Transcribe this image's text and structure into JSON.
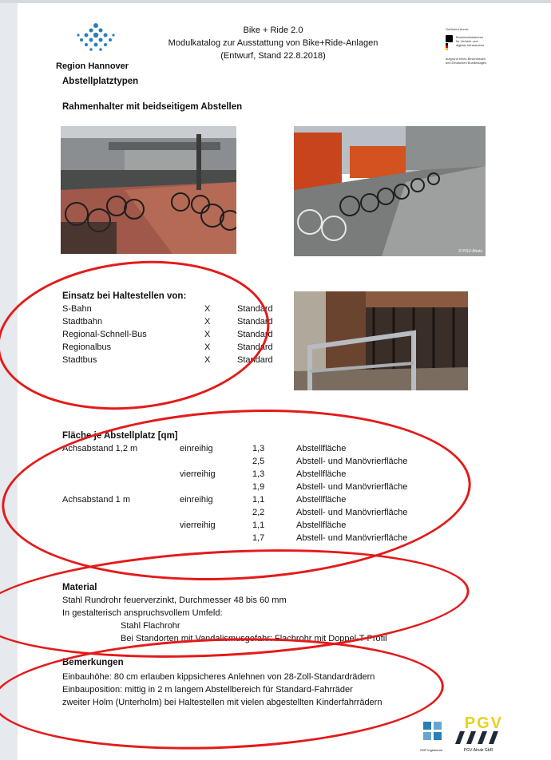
{
  "header": {
    "org": "Region Hannover",
    "line1": "Bike + Ride 2.0",
    "line2": "Modulkatalog zur Ausstattung von Bike+Ride-Anlagen",
    "line3": "(Entwurf, Stand 22.8.2018)",
    "funder_top": "Gefördert durch:",
    "funder_ministry": [
      "Bundesministerium",
      "für Verkehr und",
      "digitale Infrastruktur"
    ],
    "funder_bottom": [
      "aufgrund eines Beschlusses",
      "des Deutschen Bundestages"
    ]
  },
  "section_title": "Abstellplatztypen",
  "subtitle": "Rahmenhalter mit beidseitigem Abstellen",
  "photo_credit": "© PGV-Alrutz",
  "einsatz": {
    "heading": "Einsatz bei Haltestellen von:",
    "rows": [
      {
        "name": "S-Bahn",
        "mark": "X",
        "status": "Standard"
      },
      {
        "name": "Stadtbahn",
        "mark": "X",
        "status": "Standard"
      },
      {
        "name": "Regional-Schnell-Bus",
        "mark": "X",
        "status": "Standard"
      },
      {
        "name": "Regionalbus",
        "mark": "X",
        "status": "Standard"
      },
      {
        "name": "Stadtbus",
        "mark": "X",
        "status": "Standard"
      }
    ]
  },
  "flaeche": {
    "heading": "Fläche je Abstellplatz [qm]",
    "rows": [
      {
        "a": "Achsabstand 1,2 m",
        "b": "einreihig",
        "v": "1,3",
        "d": "Abstellfläche"
      },
      {
        "a": "",
        "b": "",
        "v": "2,5",
        "d": "Abstell- und Manövrierfläche"
      },
      {
        "a": "",
        "b": "vierreihig",
        "v": "1,3",
        "d": "Abstellfläche"
      },
      {
        "a": "",
        "b": "",
        "v": "1,9",
        "d": "Abstell- und Manövrierfläche"
      },
      {
        "a": "Achsabstand 1 m",
        "b": "einreihig",
        "v": "1,1",
        "d": "Abstellfläche"
      },
      {
        "a": "",
        "b": "",
        "v": "2,2",
        "d": "Abstell- und Manövrierfläche"
      },
      {
        "a": "",
        "b": "vierreihig",
        "v": "1,1",
        "d": "Abstellfläche"
      },
      {
        "a": "",
        "b": "",
        "v": "1,7",
        "d": "Abstell- und Manövrierfläche"
      }
    ]
  },
  "material": {
    "heading": "Material",
    "l1": "Stahl Rundrohr feuerverzinkt, Durchmesser 48 bis 60 mm",
    "l2": "In gestalterisch anspruchsvollem Umfeld:",
    "l3": "Stahl Flachrohr",
    "l4": "Bei Standorten mit Vandalismusgefahr: Flachrohr mit Doppel-T-Profil"
  },
  "bemerkungen": {
    "heading": "Bemerkungen",
    "l1": "Einbauhöhe: 80 cm erlauben kippsicheres Anlehnen von 28-Zoll-Standardrädern",
    "l2": "Einbauposition: mittig in 2 m langem Abstellbereich für Standard-Fahrräder",
    "l3": "zweiter Holm (Unterholm) bei Haltestellen mit vielen abgestellten Kinderfahrrädern"
  },
  "footer": {
    "shp_text": "SHP Ingenieure",
    "pgv_text": "PGV",
    "pgv_sub": "PGV-Alrutz GbR"
  },
  "colors": {
    "annotation": "#e41a1a",
    "pgv_yellow": "#e8d21a",
    "logo_blue": "#2a7fb8"
  }
}
